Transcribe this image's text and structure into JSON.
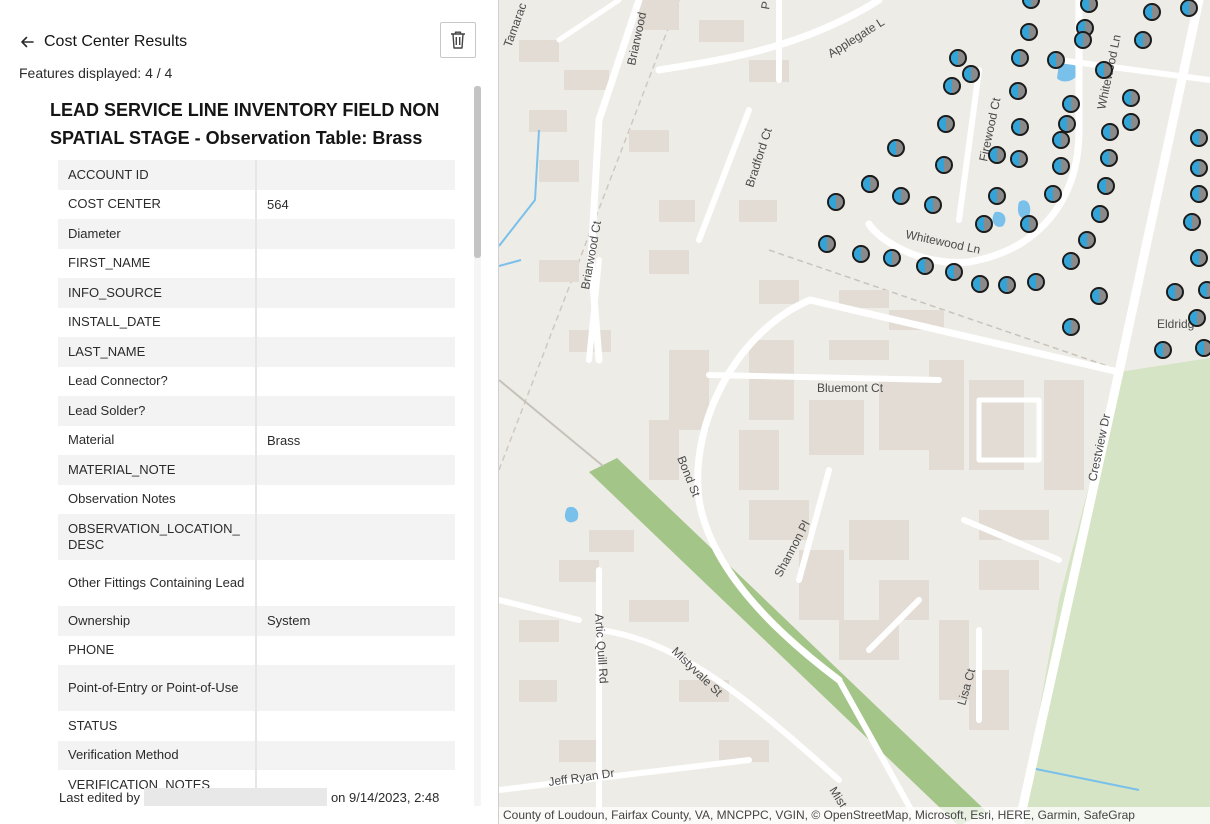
{
  "panel": {
    "back_label": "Cost Center Results",
    "features_count": "Features displayed: 4 / 4",
    "popup_title": "LEAD SERVICE LINE INVENTORY FIELD NON SPATIAL STAGE - Observation Table: Brass",
    "fields": [
      {
        "name": "ACCOUNT ID",
        "value": ""
      },
      {
        "name": "COST CENTER",
        "value": "564"
      },
      {
        "name": "Diameter",
        "value": ""
      },
      {
        "name": "FIRST_NAME",
        "value": ""
      },
      {
        "name": "INFO_SOURCE",
        "value": ""
      },
      {
        "name": "INSTALL_DATE",
        "value": ""
      },
      {
        "name": "LAST_NAME",
        "value": ""
      },
      {
        "name": "Lead Connector?",
        "value": ""
      },
      {
        "name": "Lead Solder?",
        "value": ""
      },
      {
        "name": "Material",
        "value": "Brass"
      },
      {
        "name": "MATERIAL_NOTE",
        "value": ""
      },
      {
        "name": "Observation Notes",
        "value": ""
      },
      {
        "name": "OBSERVATION_LOCATION_ DESC",
        "value": ""
      },
      {
        "name": "Other Fittings Containing Lead",
        "value": ""
      },
      {
        "name": "Ownership",
        "value": "System"
      },
      {
        "name": "PHONE",
        "value": ""
      },
      {
        "name": "Point-of-Entry or Point-of-Use",
        "value": ""
      },
      {
        "name": "STATUS",
        "value": ""
      },
      {
        "name": "Verification Method",
        "value": ""
      },
      {
        "name": "VERIFICATION_NOTES",
        "value": ""
      }
    ],
    "last_edited_prefix": "Last edited by",
    "last_edited_suffix": "on 9/14/2023, 2:48"
  },
  "map": {
    "streets": {
      "tamarack": "Tamarac",
      "briarwood_top": "Briarwood",
      "applegate": "Applegate L",
      "whitewood_ln_n": "Whitewood Ln",
      "firewood_ct": "Firewood Ct",
      "bradford_ct": "Bradford Ct",
      "briarwood_ct": "Briarwood Ct",
      "whitewood_ln": "Whitewood Ln",
      "eldridge": "Eldridg",
      "bluemont_ct": "Bluemont Ct",
      "crestview_dr": "Crestview Dr",
      "bond_st": "Bond St",
      "shannon_pl": "Shannon Pl",
      "artic_quill_rd": "Artic Quill Rd",
      "mistyvale_st": "Mistyvale St",
      "lisa_ct": "Lisa Ct",
      "jeff_ryan_dr": "Jeff Ryan Dr",
      "mist": "Mist",
      "p_top": "P"
    },
    "attribution": "County of Loudoun, Fairfax County, VA, MNCPPC, VGIN, © OpenStreetMap, Microsoft, Esri, HERE, Garmin, SafeGrap",
    "colors": {
      "background": "#eeece7",
      "road": "#ffffff",
      "building": "#e2dcd4",
      "park": "#d5e4c5",
      "green_strip": "#a3c587",
      "water": "#79c0ea",
      "marker_blue": "#32a4d8",
      "marker_gray": "#8a8a8a"
    }
  }
}
